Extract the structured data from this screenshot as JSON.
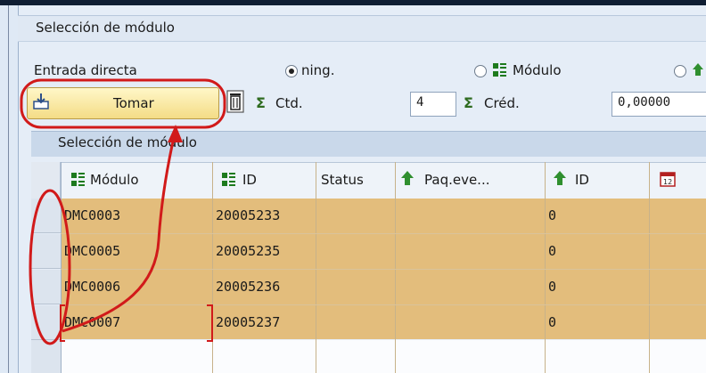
{
  "panel": {
    "title": "Selección de módulo"
  },
  "entry": {
    "label": "Entrada directa",
    "radio_ning": "ning.",
    "radio_modulo": "Módulo"
  },
  "toolbar": {
    "tomar_label": "Tomar",
    "ctd_label": "Ctd.",
    "ctd_value": "4",
    "cred_label": "Créd.",
    "cred_value": "0,00000"
  },
  "section": {
    "title": "Selección de módulo"
  },
  "table": {
    "columns": [
      "Módulo",
      "ID",
      "Status",
      "Paq.eve...",
      "ID"
    ],
    "rows": [
      {
        "modulo": "DMC0003",
        "id": "20005233",
        "status": "",
        "paq": "",
        "id2": "0"
      },
      {
        "modulo": "DMC0005",
        "id": "20005235",
        "status": "",
        "paq": "",
        "id2": "0"
      },
      {
        "modulo": "DMC0006",
        "id": "20005236",
        "status": "",
        "paq": "",
        "id2": "0"
      },
      {
        "modulo": "DMC0007",
        "id": "20005237",
        "status": "",
        "paq": "",
        "id2": "0"
      }
    ]
  },
  "colors": {
    "row_fill": "#e3bd7c",
    "annotation": "#d11a1a",
    "accent_green": "#2e6b1f"
  },
  "icons": [
    "module-icon",
    "trash-icon",
    "sigma-icon",
    "event-package-icon",
    "calendar-icon",
    "take-over-icon"
  ]
}
